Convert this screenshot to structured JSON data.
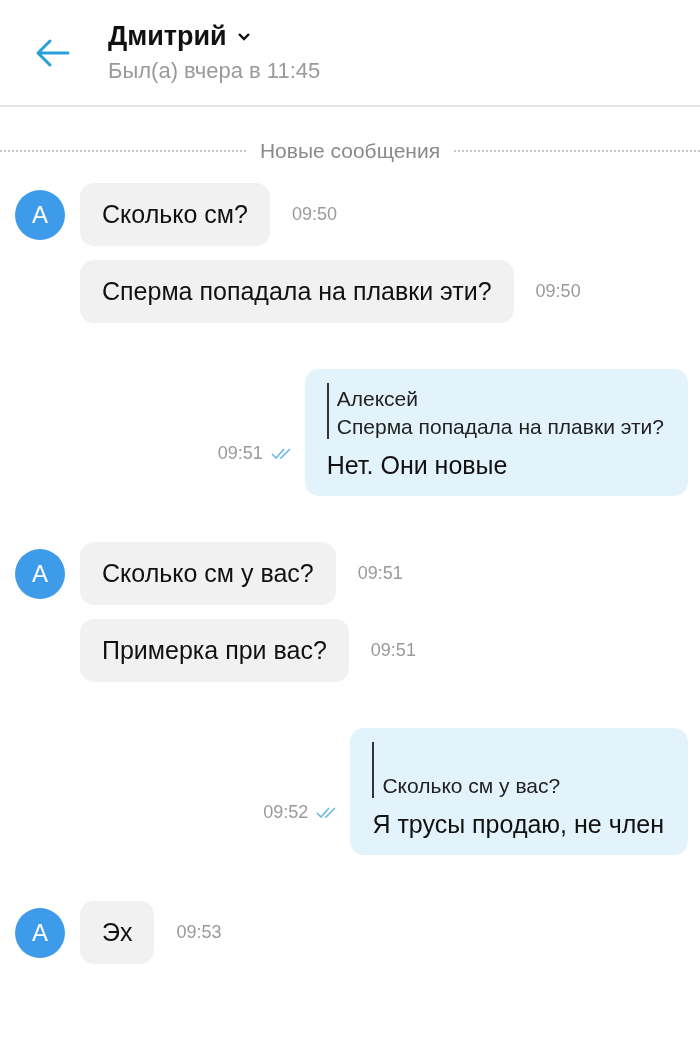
{
  "header": {
    "name": "Дмитрий",
    "status": "Был(а) вчера в 11:45"
  },
  "divider": {
    "label": "Новые сообщения"
  },
  "messages": [
    {
      "kind": "incoming",
      "avatar": "A",
      "text": "Сколько см?",
      "time": "09:50"
    },
    {
      "kind": "incoming",
      "text": "Сперма попадала на плавки эти?",
      "time": "09:50"
    },
    {
      "kind": "outgoing",
      "quote": {
        "author": "Алексей",
        "text": "Сперма попадала на плавки эти?"
      },
      "text": "Нет. Они новые",
      "time": "09:51",
      "read": true
    },
    {
      "kind": "incoming",
      "avatar": "A",
      "text": "Сколько см у вас?",
      "time": "09:51"
    },
    {
      "kind": "incoming",
      "text": "Примерка при вас?",
      "time": "09:51"
    },
    {
      "kind": "outgoing",
      "quote": {
        "text": "Сколько см у вас?"
      },
      "text": "Я трусы продаю, не член",
      "time": "09:52",
      "read": true
    },
    {
      "kind": "incoming",
      "avatar": "A",
      "text": "Эх",
      "time": "09:53"
    }
  ]
}
